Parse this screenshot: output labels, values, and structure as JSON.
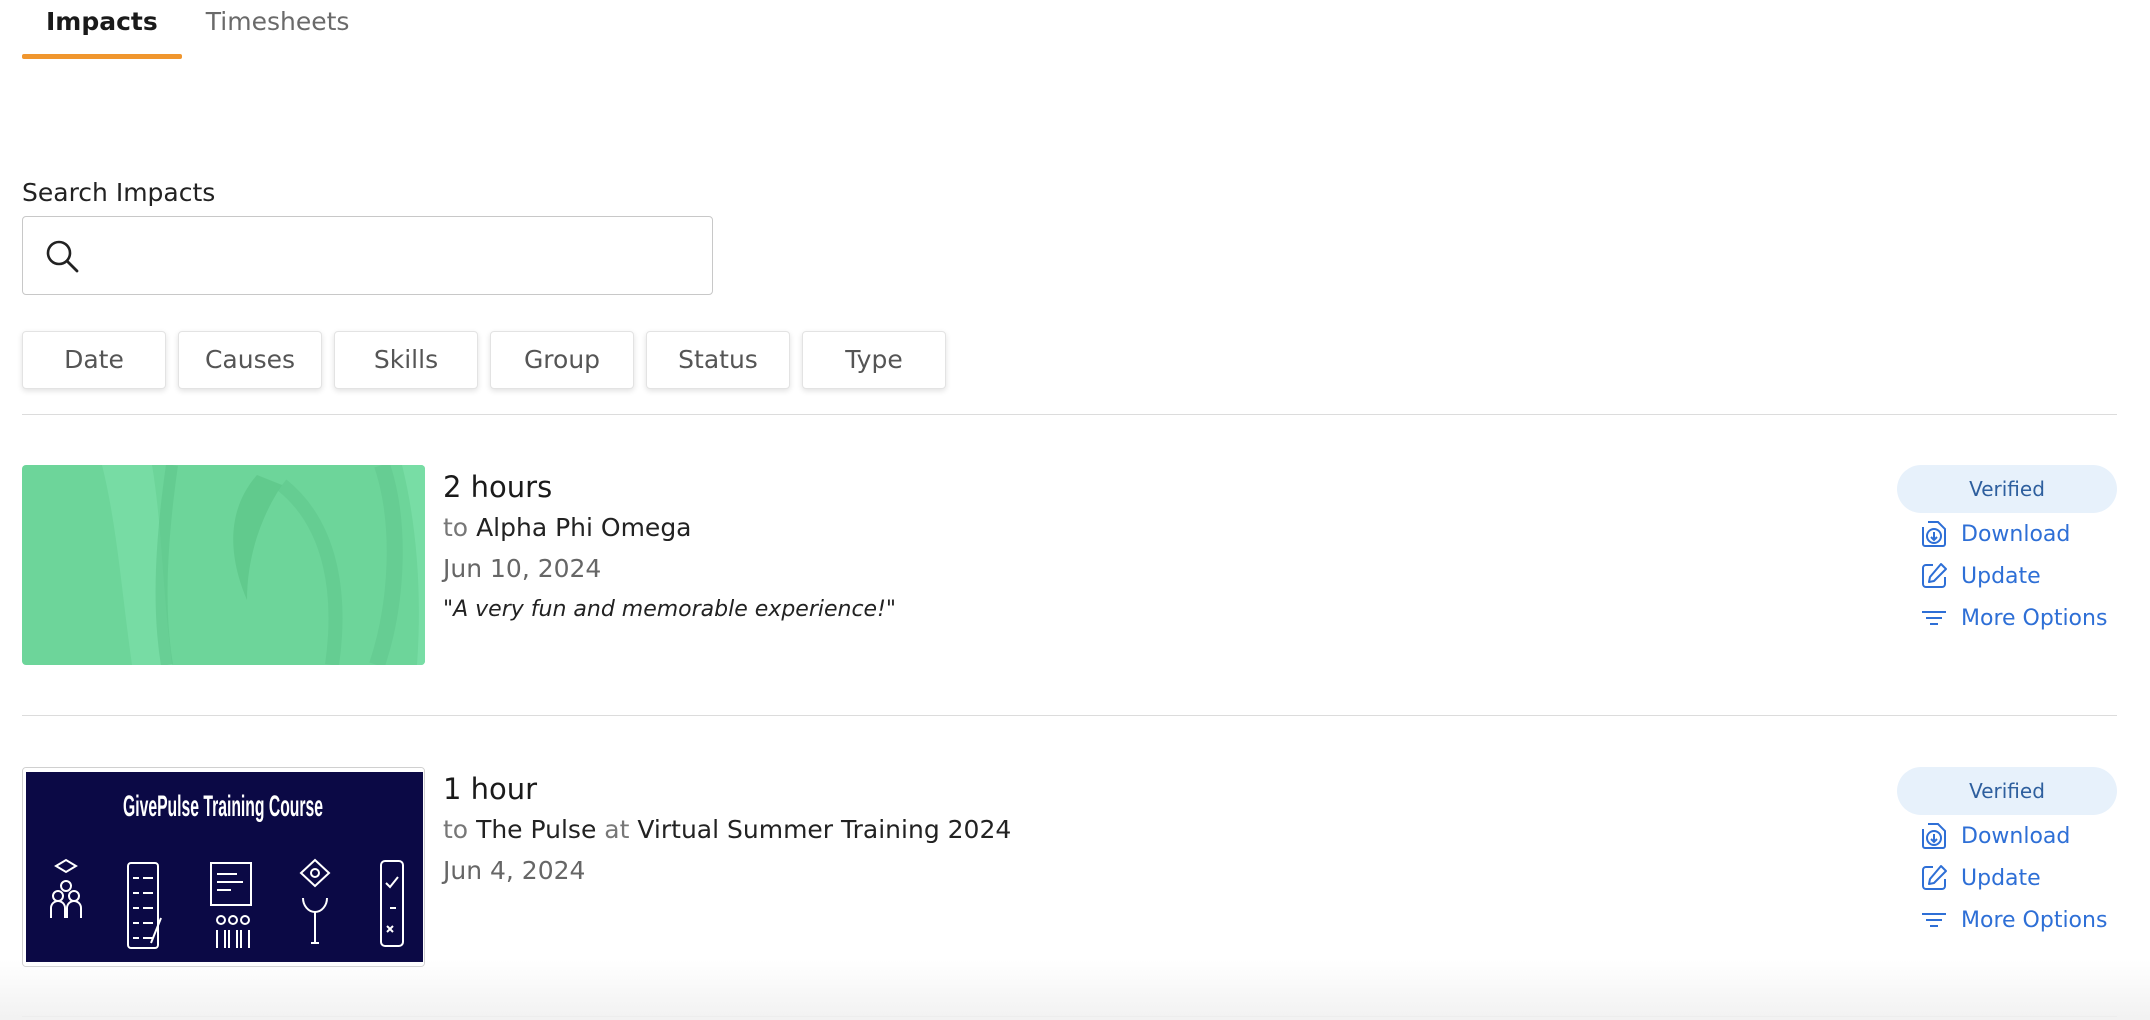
{
  "tabs": [
    {
      "label": "Impacts",
      "active": true
    },
    {
      "label": "Timesheets",
      "active": false
    }
  ],
  "search": {
    "label": "Search Impacts",
    "value": "",
    "placeholder": ""
  },
  "filters": [
    "Date",
    "Causes",
    "Skills",
    "Group",
    "Status",
    "Type"
  ],
  "impacts": [
    {
      "hours": "2 hours",
      "to_prefix": "to",
      "organization": "Alpha Phi Omega",
      "date": "Jun 10, 2024",
      "quote": "\"A very fun and memorable experience!\"",
      "status": "Verified",
      "actions": {
        "download": "Download",
        "update": "Update",
        "more": "More Options"
      },
      "thumbnail": {
        "kind": "green-pattern",
        "color": "#6dd59a"
      }
    },
    {
      "hours": "1 hour",
      "to_prefix": "to",
      "organization": "The Pulse",
      "at_prefix": "at",
      "event": "Virtual Summer Training 2024",
      "date": "Jun 4, 2024",
      "status": "Verified",
      "actions": {
        "download": "Download",
        "update": "Update",
        "more": "More Options"
      },
      "thumbnail": {
        "kind": "training-banner",
        "title": "GivePulse Training Course",
        "color": "#0b0945"
      }
    }
  ],
  "colors": {
    "accent": "#f0962e",
    "link": "#2e6fd6",
    "badge_bg": "#e7f1fb"
  }
}
